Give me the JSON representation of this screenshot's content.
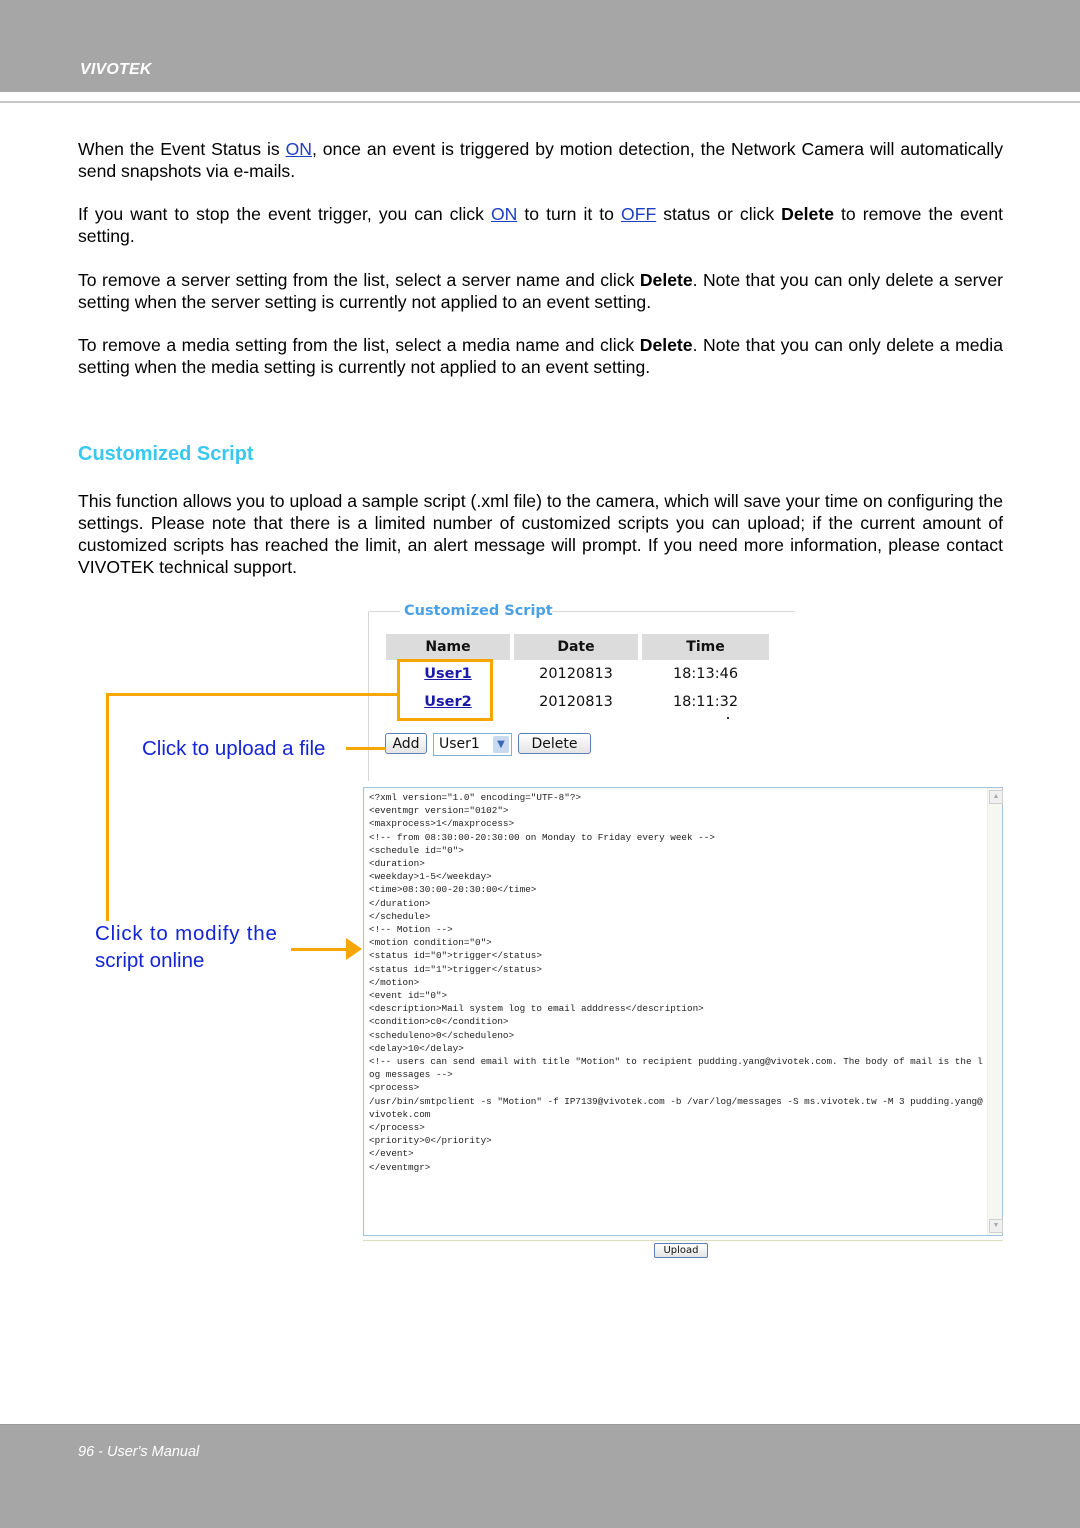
{
  "header": {
    "brand": "VIVOTEK"
  },
  "paragraphs": {
    "p1": {
      "before": "When the Event Status is ",
      "link": "ON",
      "after": ", once an event is triggered by motion detection, the Network Camera will automatically send snapshots via e-mails."
    },
    "p2": {
      "a": "If you want to stop the event trigger, you can click ",
      "link1": "ON",
      "b": " to turn it to ",
      "link2": "OFF",
      "c": " status or click ",
      "bold": "Delete",
      "d": " to remove the event setting."
    },
    "p3": {
      "a": "To remove a server setting from the list, select a server name and click ",
      "bold": "Delete",
      "b": ". Note that you can only delete a server setting when the server setting is currently not applied to an event setting."
    },
    "p4": {
      "a": "To remove a media setting from the list, select a media name and click ",
      "bold": "Delete",
      "b": ". Note that you can only delete a media setting when the media setting is currently not applied to an event setting."
    },
    "p5": "This function allows you to upload a sample script (.xml file) to the camera, which will save your time on configuring the settings. Please note that there is a limited number of customized scripts you can upload; if the current amount of customized scripts has reached the limit, an alert message will prompt. If you need more information, please contact VIVOTEK technical support."
  },
  "section_title": "Customized Script",
  "figure": {
    "legend": "Customized Script",
    "table": {
      "headers": [
        "Name",
        "Date",
        "Time"
      ],
      "rows": [
        {
          "name": "User1",
          "date": "20120813",
          "time": "18:13:46"
        },
        {
          "name": "User2",
          "date": "20120813",
          "time": "18:11:32"
        }
      ]
    },
    "add_label": "Add",
    "select_value": "User1",
    "delete_label": "Delete",
    "script_content": "<?xml version=\"1.0\" encoding=\"UTF-8\"?>\n<eventmgr version=\"0102\">\n<maxprocess>1</maxprocess>\n<!-- from 08:30:00-20:30:00 on Monday to Friday every week -->\n<schedule id=\"0\">\n<duration>\n<weekday>1-5</weekday>\n<time>08:30:00-20:30:00</time>\n</duration>\n</schedule>\n<!-- Motion -->\n<motion condition=\"0\">\n<status id=\"0\">trigger</status>\n<status id=\"1\">trigger</status>\n</motion>\n<event id=\"0\">\n<description>Mail system log to email adddress</description>\n<condition>c0</condition>\n<scheduleno>0</scheduleno>\n<delay>10</delay>\n<!-- users can send email with title \"Motion\" to recipient pudding.yang@vivotek.com. The body of mail is the log messages -->\n<process>\n/usr/bin/smtpclient -s \"Motion\" -f IP7139@vivotek.com -b /var/log/messages -S ms.vivotek.tw -M 3 pudding.yang@vivotek.com\n</process>\n<priority>0</priority>\n</event>\n</eventmgr>",
    "upload_label": "Upload"
  },
  "annotations": {
    "upload_hint": "Click to upload a file",
    "modify_hint_line1": "Click to modify the",
    "modify_hint_line2": "script online"
  },
  "colors": {
    "accent_title": "#39c8f0",
    "annotation_orange": "#f7a600",
    "annotation_text": "#1325d6",
    "link": "#1a3fc2",
    "header_bg": "#a6a6a6"
  },
  "footer": {
    "page_label": "96 - User's Manual"
  }
}
